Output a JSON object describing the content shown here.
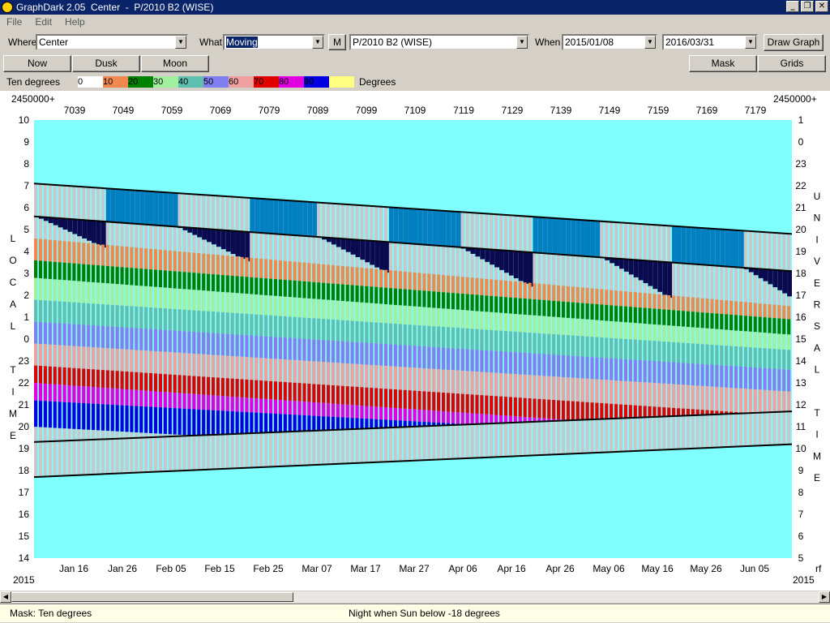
{
  "window": {
    "title": "GraphDark 2.05  Center  -  P/2010 B2 (WISE)",
    "min": "_",
    "restore": "❐",
    "close": "✕"
  },
  "menu": [
    {
      "label": "File"
    },
    {
      "label": "Edit"
    },
    {
      "label": "Help"
    }
  ],
  "toolbar": {
    "where_label": "Where",
    "where_value": "Center",
    "what_label": "What",
    "what_value": "Moving",
    "m_button": "M",
    "object_value": "P/2010 B2 (WISE)",
    "when_label": "When",
    "start_date": "2015/01/08",
    "end_date": "2016/03/31",
    "draw_button": "Draw Graph"
  },
  "buttons": {
    "now": "Now",
    "dusk": "Dusk",
    "moon": "Moon",
    "mask": "Mask",
    "grids": "Grids"
  },
  "legend": {
    "title": "Ten degrees",
    "unit": "Degrees",
    "swatches": [
      {
        "label": "0",
        "color": "#ffffff"
      },
      {
        "label": "10",
        "color": "#f08850"
      },
      {
        "label": "20",
        "color": "#008000"
      },
      {
        "label": "30",
        "color": "#a0f0a0"
      },
      {
        "label": "40",
        "color": "#60c0b0"
      },
      {
        "label": "50",
        "color": "#8080f0"
      },
      {
        "label": "60",
        "color": "#f0a0a0"
      },
      {
        "label": "70",
        "color": "#e00000"
      },
      {
        "label": "80",
        "color": "#e000e0"
      },
      {
        "label": "90",
        "color": "#0000e0"
      },
      {
        "label": "",
        "color": "#ffff80"
      }
    ]
  },
  "chart_data": {
    "type": "area",
    "jd_prefix": "2450000+",
    "jd_ticks": [
      "7039",
      "7049",
      "7059",
      "7069",
      "7079",
      "7089",
      "7099",
      "7109",
      "7119",
      "7129",
      "7139",
      "7149",
      "7159",
      "7169",
      "7179"
    ],
    "date_ticks": [
      "Jan 16",
      "Jan 26",
      "Feb 05",
      "Feb 15",
      "Feb 25",
      "Mar 07",
      "Mar 17",
      "Mar 27",
      "Apr 06",
      "Apr 16",
      "Apr 26",
      "May 06",
      "May 16",
      "May 26",
      "Jun 05"
    ],
    "year_left": "2015",
    "year_right": "2015",
    "right_corner": "rf",
    "left_axis_label": "LOCAL TIME",
    "left_axis_ticks": [
      "10",
      "9",
      "8",
      "7",
      "6",
      "5",
      "4",
      "3",
      "2",
      "1",
      "0",
      "23",
      "22",
      "21",
      "20",
      "19",
      "18",
      "17",
      "16",
      "15",
      "14"
    ],
    "right_axis_label": "UNIVERSAL TIME",
    "right_axis_ticks": [
      "1",
      "0",
      "23",
      "22",
      "21",
      "20",
      "19",
      "18",
      "17",
      "16",
      "15",
      "14",
      "13",
      "12",
      "11",
      "10",
      "9",
      "8",
      "7",
      "6",
      "5"
    ],
    "background_color": "#80ffff",
    "night_color": "#c8c8cc",
    "dark_color": "#0a0a50",
    "moon_color": "#0080c0",
    "day_range": [
      0,
      158
    ],
    "time_range_hours": [
      10,
      -10
    ],
    "sunrise_local": [
      7.1,
      4.8
    ],
    "astro_dawn_local": [
      5.6,
      3.1
    ],
    "sunset_local": [
      -6.3,
      -4.8
    ],
    "astro_dusk_local": [
      -4.7,
      -3.3
    ],
    "altitude_band_tops_local": [
      [
        4.6,
        1.5
      ],
      [
        3.6,
        0.9
      ],
      [
        2.8,
        0.2
      ],
      [
        1.8,
        -0.5
      ],
      [
        0.8,
        -1.4
      ],
      [
        -0.2,
        -2.4
      ],
      [
        -1.2,
        -3.5
      ],
      [
        -2.0,
        -4.4
      ],
      [
        -2.8,
        -4.7
      ]
    ]
  },
  "status": {
    "mask": "Mask:  Ten degrees",
    "night": "Night when Sun below -18 degrees"
  }
}
